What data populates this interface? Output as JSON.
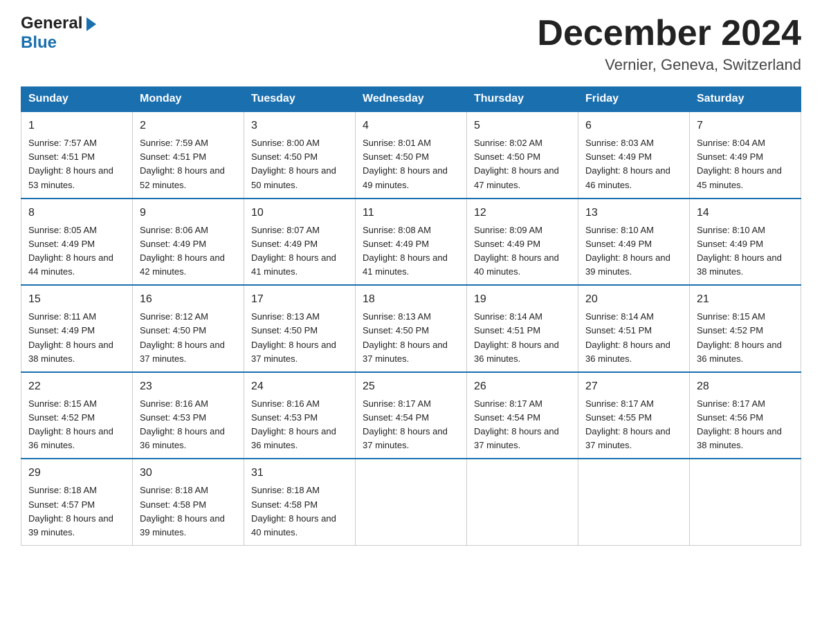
{
  "header": {
    "title": "December 2024",
    "subtitle": "Vernier, Geneva, Switzerland",
    "logo_general": "General",
    "logo_blue": "Blue"
  },
  "days_of_week": [
    "Sunday",
    "Monday",
    "Tuesday",
    "Wednesday",
    "Thursday",
    "Friday",
    "Saturday"
  ],
  "weeks": [
    [
      {
        "day": "1",
        "sunrise": "7:57 AM",
        "sunset": "4:51 PM",
        "daylight": "8 hours and 53 minutes."
      },
      {
        "day": "2",
        "sunrise": "7:59 AM",
        "sunset": "4:51 PM",
        "daylight": "8 hours and 52 minutes."
      },
      {
        "day": "3",
        "sunrise": "8:00 AM",
        "sunset": "4:50 PM",
        "daylight": "8 hours and 50 minutes."
      },
      {
        "day": "4",
        "sunrise": "8:01 AM",
        "sunset": "4:50 PM",
        "daylight": "8 hours and 49 minutes."
      },
      {
        "day": "5",
        "sunrise": "8:02 AM",
        "sunset": "4:50 PM",
        "daylight": "8 hours and 47 minutes."
      },
      {
        "day": "6",
        "sunrise": "8:03 AM",
        "sunset": "4:49 PM",
        "daylight": "8 hours and 46 minutes."
      },
      {
        "day": "7",
        "sunrise": "8:04 AM",
        "sunset": "4:49 PM",
        "daylight": "8 hours and 45 minutes."
      }
    ],
    [
      {
        "day": "8",
        "sunrise": "8:05 AM",
        "sunset": "4:49 PM",
        "daylight": "8 hours and 44 minutes."
      },
      {
        "day": "9",
        "sunrise": "8:06 AM",
        "sunset": "4:49 PM",
        "daylight": "8 hours and 42 minutes."
      },
      {
        "day": "10",
        "sunrise": "8:07 AM",
        "sunset": "4:49 PM",
        "daylight": "8 hours and 41 minutes."
      },
      {
        "day": "11",
        "sunrise": "8:08 AM",
        "sunset": "4:49 PM",
        "daylight": "8 hours and 41 minutes."
      },
      {
        "day": "12",
        "sunrise": "8:09 AM",
        "sunset": "4:49 PM",
        "daylight": "8 hours and 40 minutes."
      },
      {
        "day": "13",
        "sunrise": "8:10 AM",
        "sunset": "4:49 PM",
        "daylight": "8 hours and 39 minutes."
      },
      {
        "day": "14",
        "sunrise": "8:10 AM",
        "sunset": "4:49 PM",
        "daylight": "8 hours and 38 minutes."
      }
    ],
    [
      {
        "day": "15",
        "sunrise": "8:11 AM",
        "sunset": "4:49 PM",
        "daylight": "8 hours and 38 minutes."
      },
      {
        "day": "16",
        "sunrise": "8:12 AM",
        "sunset": "4:50 PM",
        "daylight": "8 hours and 37 minutes."
      },
      {
        "day": "17",
        "sunrise": "8:13 AM",
        "sunset": "4:50 PM",
        "daylight": "8 hours and 37 minutes."
      },
      {
        "day": "18",
        "sunrise": "8:13 AM",
        "sunset": "4:50 PM",
        "daylight": "8 hours and 37 minutes."
      },
      {
        "day": "19",
        "sunrise": "8:14 AM",
        "sunset": "4:51 PM",
        "daylight": "8 hours and 36 minutes."
      },
      {
        "day": "20",
        "sunrise": "8:14 AM",
        "sunset": "4:51 PM",
        "daylight": "8 hours and 36 minutes."
      },
      {
        "day": "21",
        "sunrise": "8:15 AM",
        "sunset": "4:52 PM",
        "daylight": "8 hours and 36 minutes."
      }
    ],
    [
      {
        "day": "22",
        "sunrise": "8:15 AM",
        "sunset": "4:52 PM",
        "daylight": "8 hours and 36 minutes."
      },
      {
        "day": "23",
        "sunrise": "8:16 AM",
        "sunset": "4:53 PM",
        "daylight": "8 hours and 36 minutes."
      },
      {
        "day": "24",
        "sunrise": "8:16 AM",
        "sunset": "4:53 PM",
        "daylight": "8 hours and 36 minutes."
      },
      {
        "day": "25",
        "sunrise": "8:17 AM",
        "sunset": "4:54 PM",
        "daylight": "8 hours and 37 minutes."
      },
      {
        "day": "26",
        "sunrise": "8:17 AM",
        "sunset": "4:54 PM",
        "daylight": "8 hours and 37 minutes."
      },
      {
        "day": "27",
        "sunrise": "8:17 AM",
        "sunset": "4:55 PM",
        "daylight": "8 hours and 37 minutes."
      },
      {
        "day": "28",
        "sunrise": "8:17 AM",
        "sunset": "4:56 PM",
        "daylight": "8 hours and 38 minutes."
      }
    ],
    [
      {
        "day": "29",
        "sunrise": "8:18 AM",
        "sunset": "4:57 PM",
        "daylight": "8 hours and 39 minutes."
      },
      {
        "day": "30",
        "sunrise": "8:18 AM",
        "sunset": "4:58 PM",
        "daylight": "8 hours and 39 minutes."
      },
      {
        "day": "31",
        "sunrise": "8:18 AM",
        "sunset": "4:58 PM",
        "daylight": "8 hours and 40 minutes."
      },
      null,
      null,
      null,
      null
    ]
  ]
}
